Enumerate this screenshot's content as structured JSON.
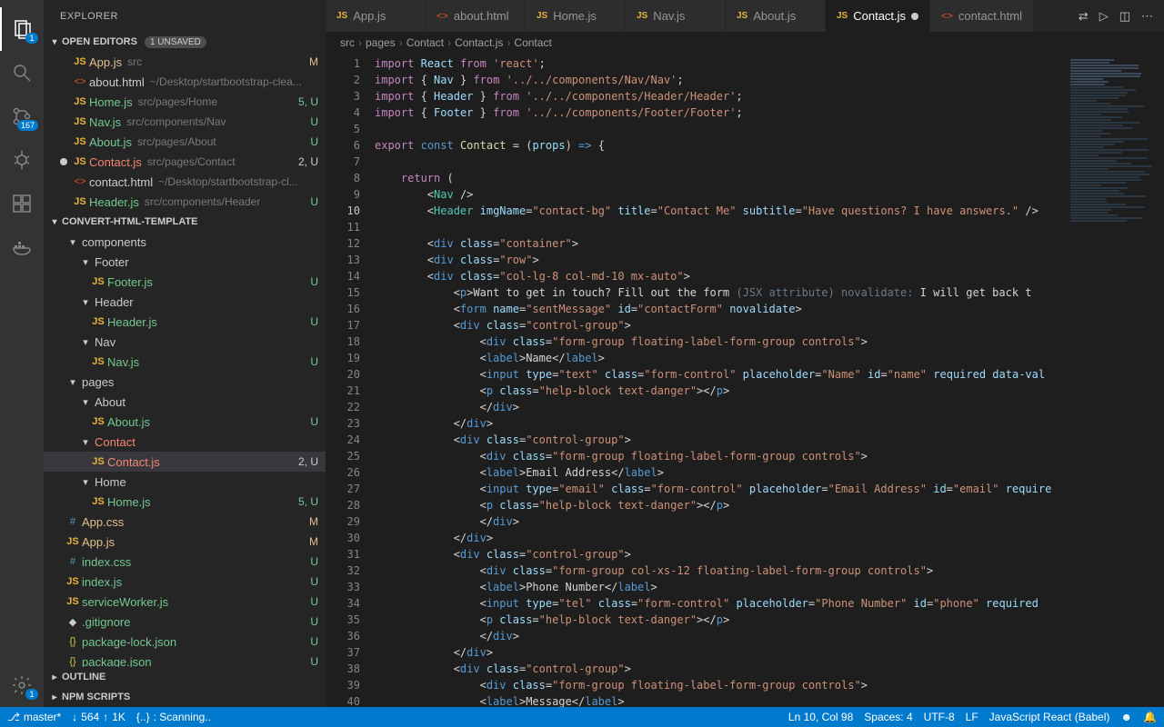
{
  "sidebar": {
    "title": "EXPLORER",
    "openEditors": {
      "label": "OPEN EDITORS",
      "unsaved": "1 UNSAVED",
      "items": [
        {
          "name": "App.js",
          "sub": "src",
          "status": "M",
          "cls": "modified",
          "icon": "JS"
        },
        {
          "name": "about.html",
          "sub": "~/Desktop/startbootstrap-clea...",
          "status": "",
          "cls": "",
          "icon": "<>"
        },
        {
          "name": "Home.js",
          "sub": "src/pages/Home",
          "status": "5, U",
          "cls": "untracked",
          "icon": "JS"
        },
        {
          "name": "Nav.js",
          "sub": "src/components/Nav",
          "status": "U",
          "cls": "untracked",
          "icon": "JS"
        },
        {
          "name": "About.js",
          "sub": "src/pages/About",
          "status": "U",
          "cls": "untracked",
          "icon": "JS"
        },
        {
          "name": "Contact.js",
          "sub": "src/pages/Contact",
          "status": "2, U",
          "cls": "error",
          "icon": "JS",
          "dirty": true
        },
        {
          "name": "contact.html",
          "sub": "~/Desktop/startbootstrap-cl...",
          "status": "",
          "cls": "",
          "icon": "<>"
        },
        {
          "name": "Header.js",
          "sub": "src/components/Header",
          "status": "U",
          "cls": "untracked",
          "icon": "JS"
        }
      ]
    },
    "project": {
      "label": "CONVERT-HTML-TEMPLATE",
      "tree": [
        {
          "depth": 1,
          "name": "components",
          "type": "folder",
          "open": true
        },
        {
          "depth": 2,
          "name": "Footer",
          "type": "folder",
          "open": true
        },
        {
          "depth": 3,
          "name": "Footer.js",
          "type": "file",
          "icon": "JS",
          "status": "U",
          "cls": "untracked"
        },
        {
          "depth": 2,
          "name": "Header",
          "type": "folder",
          "open": true
        },
        {
          "depth": 3,
          "name": "Header.js",
          "type": "file",
          "icon": "JS",
          "status": "U",
          "cls": "untracked"
        },
        {
          "depth": 2,
          "name": "Nav",
          "type": "folder",
          "open": true
        },
        {
          "depth": 3,
          "name": "Nav.js",
          "type": "file",
          "icon": "JS",
          "status": "U",
          "cls": "untracked"
        },
        {
          "depth": 1,
          "name": "pages",
          "type": "folder",
          "open": true
        },
        {
          "depth": 2,
          "name": "About",
          "type": "folder",
          "open": true
        },
        {
          "depth": 3,
          "name": "About.js",
          "type": "file",
          "icon": "JS",
          "status": "U",
          "cls": "untracked"
        },
        {
          "depth": 2,
          "name": "Contact",
          "type": "folder",
          "open": true,
          "cls": "error"
        },
        {
          "depth": 3,
          "name": "Contact.js",
          "type": "file",
          "icon": "JS",
          "status": "2, U",
          "cls": "error",
          "selected": true
        },
        {
          "depth": 2,
          "name": "Home",
          "type": "folder",
          "open": true
        },
        {
          "depth": 3,
          "name": "Home.js",
          "type": "file",
          "icon": "JS",
          "status": "5, U",
          "cls": "untracked"
        },
        {
          "depth": 1,
          "name": "App.css",
          "type": "file",
          "icon": "#",
          "status": "M",
          "cls": "modified"
        },
        {
          "depth": 1,
          "name": "App.js",
          "type": "file",
          "icon": "JS",
          "status": "M",
          "cls": "modified"
        },
        {
          "depth": 1,
          "name": "index.css",
          "type": "file",
          "icon": "#",
          "status": "U",
          "cls": "untracked"
        },
        {
          "depth": 1,
          "name": "index.js",
          "type": "file",
          "icon": "JS",
          "status": "U",
          "cls": "untracked"
        },
        {
          "depth": 1,
          "name": "serviceWorker.js",
          "type": "file",
          "icon": "JS",
          "status": "U",
          "cls": "untracked"
        },
        {
          "depth": 1,
          "name": ".gitignore",
          "type": "file",
          "icon": "◆",
          "status": "U",
          "cls": "untracked"
        },
        {
          "depth": 1,
          "name": "package-lock.json",
          "type": "file",
          "icon": "{}",
          "status": "U",
          "cls": "untracked"
        },
        {
          "depth": 1,
          "name": "package.json",
          "type": "file",
          "icon": "{}",
          "status": "U",
          "cls": "untracked"
        }
      ]
    },
    "outline": "OUTLINE",
    "npm": "NPM SCRIPTS"
  },
  "tabs": [
    {
      "name": "App.js",
      "icon": "JS"
    },
    {
      "name": "about.html",
      "icon": "<>"
    },
    {
      "name": "Home.js",
      "icon": "JS"
    },
    {
      "name": "Nav.js",
      "icon": "JS"
    },
    {
      "name": "About.js",
      "icon": "JS"
    },
    {
      "name": "Contact.js",
      "icon": "JS",
      "active": true,
      "dirty": true
    },
    {
      "name": "contact.html",
      "icon": "<>"
    }
  ],
  "breadcrumb": [
    "src",
    "pages",
    "Contact",
    "Contact.js",
    "Contact"
  ],
  "code": {
    "lines": [
      {
        "n": 1,
        "html": "<span class='kw'>import</span> <span class='var'>React</span> <span class='kw'>from</span> <span class='str'>'react'</span>;"
      },
      {
        "n": 2,
        "html": "<span class='kw'>import</span> { <span class='var'>Nav</span> } <span class='kw'>from</span> <span class='str'>'../../components/Nav/Nav'</span>;"
      },
      {
        "n": 3,
        "html": "<span class='kw'>import</span> { <span class='var'>Header</span> } <span class='kw'>from</span> <span class='str'>'../../components/Header/Header'</span>;"
      },
      {
        "n": 4,
        "html": "<span class='kw'>import</span> { <span class='var'>Footer</span> } <span class='kw'>from</span> <span class='str'>'../../components/Footer/Footer'</span>;"
      },
      {
        "n": 5,
        "html": ""
      },
      {
        "n": 6,
        "html": "<span class='kw'>export</span> <span class='kw2'>const</span> <span class='fn'>Contact</span> = (<span class='var'>props</span>) <span class='kw2'>=&gt;</span> {"
      },
      {
        "n": 7,
        "html": ""
      },
      {
        "n": 8,
        "html": "    <span class='kw'>return</span> ("
      },
      {
        "n": 9,
        "html": "        &lt;<span class='tag'>Nav</span> /&gt;"
      },
      {
        "n": 10,
        "html": "        &lt;<span class='tag'>Header</span> <span class='attr'>imgName</span>=<span class='str'>\"contact-bg\"</span> <span class='attr'>title</span>=<span class='str'>\"Contact Me\"</span> <span class='attr'>subtitle</span>=<span class='str'>\"Have questions? I have answers.\"</span> /&gt;"
      },
      {
        "n": 11,
        "html": ""
      },
      {
        "n": 12,
        "html": "        &lt;<span class='kw2'>div</span> <span class='attr'>class</span>=<span class='str'>\"container\"</span>&gt;"
      },
      {
        "n": 13,
        "html": "        &lt;<span class='kw2'>div</span> <span class='attr'>class</span>=<span class='str'>\"row\"</span>&gt;"
      },
      {
        "n": 14,
        "html": "        &lt;<span class='kw2'>div</span> <span class='attr'>class</span>=<span class='str'>\"col-lg-8 col-md-10 mx-auto\"</span>&gt;"
      },
      {
        "n": 15,
        "html": "            &lt;<span class='kw2'>p</span>&gt;<span class='txt'>Want to get in touch? Fill out the form </span><span class='hint'>(JSX attribute) novalidate:</span><span class='txt'> I will get back t</span>"
      },
      {
        "n": 16,
        "html": "            &lt;<span class='kw2'>form</span> <span class='attr'>name</span>=<span class='str'>\"sentMessage\"</span> <span class='attr'>id</span>=<span class='str'>\"contactForm\"</span> <span class='attr'>novalidate</span>&gt;"
      },
      {
        "n": 17,
        "html": "            &lt;<span class='kw2'>div</span> <span class='attr'>class</span>=<span class='str'>\"control-group\"</span>&gt;"
      },
      {
        "n": 18,
        "html": "                &lt;<span class='kw2'>div</span> <span class='attr'>class</span>=<span class='str'>\"form-group floating-label-form-group controls\"</span>&gt;"
      },
      {
        "n": 19,
        "html": "                &lt;<span class='kw2'>label</span>&gt;<span class='txt'>Name</span>&lt;/<span class='kw2'>label</span>&gt;"
      },
      {
        "n": 20,
        "html": "                &lt;<span class='kw2'>input</span> <span class='attr'>type</span>=<span class='str'>\"text\"</span> <span class='attr'>class</span>=<span class='str'>\"form-control\"</span> <span class='attr'>placeholder</span>=<span class='str'>\"Name\"</span> <span class='attr'>id</span>=<span class='str'>\"name\"</span> <span class='attr'>required</span> <span class='attr'>data-val</span>"
      },
      {
        "n": 21,
        "html": "                &lt;<span class='kw2'>p</span> <span class='attr'>class</span>=<span class='str'>\"help-block text-danger\"</span>&gt;&lt;/<span class='kw2'>p</span>&gt;"
      },
      {
        "n": 22,
        "html": "                &lt;/<span class='kw2'>div</span>&gt;"
      },
      {
        "n": 23,
        "html": "            &lt;/<span class='kw2'>div</span>&gt;"
      },
      {
        "n": 24,
        "html": "            &lt;<span class='kw2'>div</span> <span class='attr'>class</span>=<span class='str'>\"control-group\"</span>&gt;"
      },
      {
        "n": 25,
        "html": "                &lt;<span class='kw2'>div</span> <span class='attr'>class</span>=<span class='str'>\"form-group floating-label-form-group controls\"</span>&gt;"
      },
      {
        "n": 26,
        "html": "                &lt;<span class='kw2'>label</span>&gt;<span class='txt'>Email Address</span>&lt;/<span class='kw2'>label</span>&gt;"
      },
      {
        "n": 27,
        "html": "                &lt;<span class='kw2'>input</span> <span class='attr'>type</span>=<span class='str'>\"email\"</span> <span class='attr'>class</span>=<span class='str'>\"form-control\"</span> <span class='attr'>placeholder</span>=<span class='str'>\"Email Address\"</span> <span class='attr'>id</span>=<span class='str'>\"email\"</span> <span class='attr'>require</span>"
      },
      {
        "n": 28,
        "html": "                &lt;<span class='kw2'>p</span> <span class='attr'>class</span>=<span class='str'>\"help-block text-danger\"</span>&gt;&lt;/<span class='kw2'>p</span>&gt;"
      },
      {
        "n": 29,
        "html": "                &lt;/<span class='kw2'>div</span>&gt;"
      },
      {
        "n": 30,
        "html": "            &lt;/<span class='kw2'>div</span>&gt;"
      },
      {
        "n": 31,
        "html": "            &lt;<span class='kw2'>div</span> <span class='attr'>class</span>=<span class='str'>\"control-group\"</span>&gt;"
      },
      {
        "n": 32,
        "html": "                &lt;<span class='kw2'>div</span> <span class='attr'>class</span>=<span class='str'>\"form-group col-xs-12 floating-label-form-group controls\"</span>&gt;"
      },
      {
        "n": 33,
        "html": "                &lt;<span class='kw2'>label</span>&gt;<span class='txt'>Phone Number</span>&lt;/<span class='kw2'>label</span>&gt;"
      },
      {
        "n": 34,
        "html": "                &lt;<span class='kw2'>input</span> <span class='attr'>type</span>=<span class='str'>\"tel\"</span> <span class='attr'>class</span>=<span class='str'>\"form-control\"</span> <span class='attr'>placeholder</span>=<span class='str'>\"Phone Number\"</span> <span class='attr'>id</span>=<span class='str'>\"phone\"</span> <span class='attr'>required</span> "
      },
      {
        "n": 35,
        "html": "                &lt;<span class='kw2'>p</span> <span class='attr'>class</span>=<span class='str'>\"help-block text-danger\"</span>&gt;&lt;/<span class='kw2'>p</span>&gt;"
      },
      {
        "n": 36,
        "html": "                &lt;/<span class='kw2'>div</span>&gt;"
      },
      {
        "n": 37,
        "html": "            &lt;/<span class='kw2'>div</span>&gt;"
      },
      {
        "n": 38,
        "html": "            &lt;<span class='kw2'>div</span> <span class='attr'>class</span>=<span class='str'>\"control-group\"</span>&gt;"
      },
      {
        "n": 39,
        "html": "                &lt;<span class='kw2'>div</span> <span class='attr'>class</span>=<span class='str'>\"form-group floating-label-form-group controls\"</span>&gt;"
      },
      {
        "n": 40,
        "html": "                &lt;<span class='kw2'>label</span>&gt;<span class='txt'>Message</span>&lt;/<span class='kw2'>label</span>&gt;"
      }
    ]
  },
  "status": {
    "branch": "master*",
    "sync_down": "564",
    "sync_up": "1K",
    "lang_mode": "{..}",
    "scanning": ": Scanning..",
    "position": "Ln 10, Col 98",
    "spaces": "Spaces: 4",
    "encoding": "UTF-8",
    "eol": "LF",
    "language": "JavaScript React (Babel)"
  },
  "activity_badges": {
    "files": "1",
    "scm": "167",
    "settings": "1"
  }
}
